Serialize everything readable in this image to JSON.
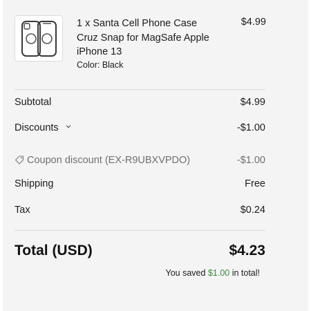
{
  "item": {
    "title": "1 x Santa Cell Phone Case Cruz Snap for MagSafe Apple iPhone 13",
    "color": "Color: Black",
    "price": "$4.99",
    "thumbnail_icon": "phone-case-image"
  },
  "summary": {
    "subtotal_label": "Subtotal",
    "subtotal_value": "$4.99",
    "discounts_label": "Discounts",
    "discounts_value": "-$1.00",
    "coupon_label": "Coupon discount (EX-R9UBXVPDO)",
    "coupon_value": "-$1.00",
    "shipping_label": "Shipping",
    "shipping_value": "Free",
    "tax_label": "Tax",
    "tax_value": "$0.24"
  },
  "total": {
    "label": "Total (USD)",
    "value": "$4.23"
  },
  "savings": {
    "prefix": "You saved ",
    "amount": "$1.00",
    "suffix": " in total!"
  },
  "colors": {
    "panel_background": "#f4f4f4",
    "savings_accent": "#3c8a3f",
    "muted_text": "#707070"
  }
}
